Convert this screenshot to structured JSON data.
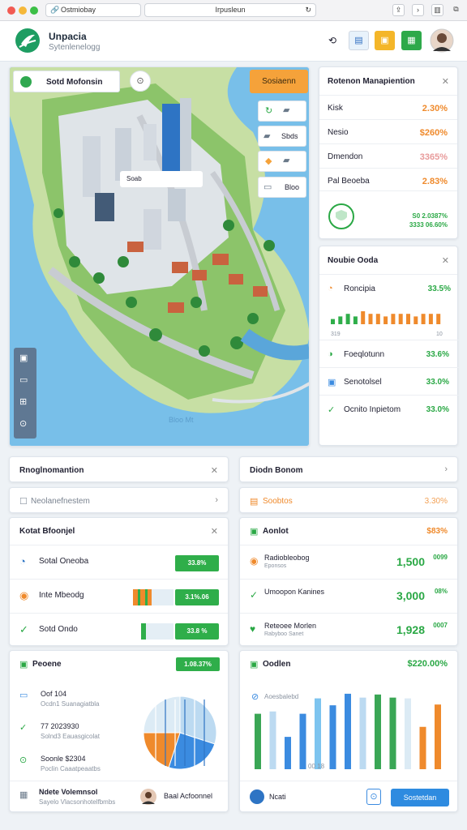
{
  "browser": {
    "tab_title": "Ostmiobay",
    "address": "Irpusleun"
  },
  "header": {
    "app_name": "Unpacia",
    "app_subtitle": "Sytenlenelogg"
  },
  "map": {
    "search_label": "Sotd Mofonsin",
    "badge_label": "Sosiaenn",
    "popup_label": "Soab",
    "road_tags": [
      "Sbds",
      "Bloo"
    ],
    "watermark": "Bloo Mt"
  },
  "right_panel": {
    "title": "Rotenon Manapiention",
    "rows": [
      {
        "label": "Kisk",
        "value": "2.30%",
        "color": "#ef8a2c"
      },
      {
        "label": "Nesio",
        "value": "$260%",
        "color": "#ef8a2c"
      },
      {
        "label": "Dmendon",
        "value": "3365%",
        "color": "#e89b9b"
      },
      {
        "label": "Pal Beoeba",
        "value": "2.83%",
        "color": "#ef8a2c"
      }
    ],
    "footer_lines": [
      "S0 2.0387%",
      "3333 06.60%"
    ]
  },
  "side_panel": {
    "title": "Noubie Ooda",
    "rows": [
      {
        "label": "Roncipia",
        "value": "33.5%",
        "icon": "clock-icon"
      },
      {
        "label": "Foeqlotunn",
        "value": "33.6%",
        "icon": "chat-icon"
      },
      {
        "label": "Senotolsel",
        "value": "33.0%",
        "icon": "grid-icon"
      },
      {
        "label": "Ocnito Inpietom",
        "value": "33.0%",
        "icon": "check-icon"
      }
    ],
    "bar_values": [
      2,
      3,
      4,
      3,
      5,
      4,
      4,
      3,
      4,
      4,
      4,
      3,
      4,
      4,
      4
    ],
    "axis_ticks": [
      "319",
      "10"
    ]
  },
  "left_cards": {
    "card1_title": "Rnoglnomantion",
    "card2_title": "Neolanefnestem",
    "card3_title": "Kotat Bfoonjel",
    "card3_rows": [
      {
        "label": "Sotal Oneoba",
        "value": "33.8%"
      },
      {
        "label": "Inte Mbeodg",
        "value": "3.1%.06"
      },
      {
        "label": "Sotd Ondo",
        "value": "33.8 %"
      }
    ],
    "progress_levels": [
      0.8,
      0.45,
      0.15
    ],
    "card4_title": "Peoene",
    "card4_pill": "1.08.37%",
    "card4_rows": [
      {
        "label": "Oof 104",
        "sub": "Ocdn1 Suanagiatbla"
      },
      {
        "label": "77 2023930",
        "sub": "Solnd3 Eauasgicolat"
      },
      {
        "label": "Soonle $2304",
        "sub": "Poclin Caaatpeaatbs"
      }
    ],
    "pie_values": [
      30,
      25,
      20,
      25
    ],
    "footer_label": "Ndete Volemnsol",
    "footer_sub": "Sayelo Vlacsonhotelfbmbs",
    "footer_user": "Baal Acfoonnel"
  },
  "right_cards": {
    "card1_title": "Diodn Bonom",
    "card2_label": "Soobtos",
    "card2_value": "3.30%",
    "card3_title": "Aonlot",
    "card3_value": "$83%",
    "card3_rows": [
      {
        "label": "Radiobleobog",
        "sub": "Eponsos",
        "value": "1,500",
        "sup": "0099",
        "icon": "clock-icon"
      },
      {
        "label": "Umoopon Kanines",
        "sub": "",
        "value": "3,000",
        "sup": "08%",
        "icon": "check-icon"
      },
      {
        "label": "Reteoee Morlen",
        "sub": "Rabyboo Sanet",
        "value": "1,928",
        "sup": "0007",
        "icon": "heart-icon"
      }
    ],
    "card4_title": "Oodlen",
    "card4_value": "$220.00%",
    "card4_caption": "Aoesbalebd",
    "bar_axis": "00 18",
    "bars": [
      {
        "h": 0.72,
        "c": "#3aa655"
      },
      {
        "h": 0.75,
        "c": "#bcdaf1"
      },
      {
        "h": 0.42,
        "c": "#3b8be0"
      },
      {
        "h": 0.72,
        "c": "#3b8be0"
      },
      {
        "h": 0.92,
        "c": "#7dc4ef"
      },
      {
        "h": 0.83,
        "c": "#3b8be0"
      },
      {
        "h": 0.98,
        "c": "#3b8be0"
      },
      {
        "h": 0.93,
        "c": "#bcdaf1"
      },
      {
        "h": 0.97,
        "c": "#3aa655"
      },
      {
        "h": 0.93,
        "c": "#3aa655"
      },
      {
        "h": 0.92,
        "c": "#dcebf5"
      },
      {
        "h": 0.55,
        "c": "#ef8a2c"
      },
      {
        "h": 0.84,
        "c": "#ef8a2c"
      }
    ],
    "footer_label": "Ncati",
    "footer_button": "Sostetdan"
  }
}
